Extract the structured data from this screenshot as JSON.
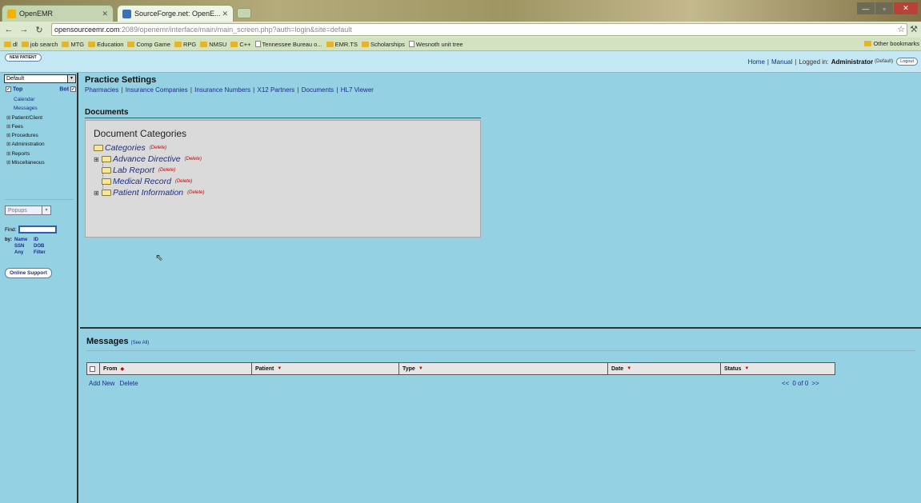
{
  "browser": {
    "tabs": [
      {
        "label": "OpenEMR",
        "active": false
      },
      {
        "label": "SourceForge.net: OpenE...",
        "active": true
      }
    ],
    "url_host": "opensourceemr.com",
    "url_path": ":2089/openemr/interface/main/main_screen.php?auth=login&site=default",
    "bookmarks": [
      "dl",
      "job search",
      "MTG",
      "Education",
      "Comp Game",
      "RPG",
      "NMSU",
      "C++",
      "Tennessee Bureau o...",
      "EMR.TS",
      "Scholarships",
      "Wesnoth unit tree"
    ],
    "other_bookmarks": "Other bookmarks"
  },
  "emr_header": {
    "new_patient_label": "NEW PATIENT",
    "home_label": "Home",
    "manual_label": "Manual",
    "logged_in_label": "Logged in:",
    "user_name": "Administrator",
    "site_label": "(Default)",
    "logout_label": "Logout"
  },
  "leftnav": {
    "frame_select": "Default",
    "top_label": "Top",
    "bot_label": "Bot",
    "items": [
      {
        "label": "Calendar",
        "kind": "sub"
      },
      {
        "label": "Messages",
        "kind": "sub"
      },
      {
        "label": "Patient/Client",
        "kind": "section"
      },
      {
        "label": "Fees",
        "kind": "section"
      },
      {
        "label": "Procedures",
        "kind": "section"
      },
      {
        "label": "Administration",
        "kind": "section"
      },
      {
        "label": "Reports",
        "kind": "section"
      },
      {
        "label": "Miscellaneous",
        "kind": "section"
      }
    ],
    "popups_label": "Popups",
    "find_label": "Find:",
    "by_label": "by:",
    "find_by": [
      "Name",
      "ID",
      "SSN",
      "DOB",
      "Any",
      "Filter"
    ],
    "online_support_label": "Online Support"
  },
  "practice_settings": {
    "title": "Practice Settings",
    "links": [
      "Pharmacies",
      "Insurance Companies",
      "Insurance Numbers",
      "X12 Partners",
      "Documents",
      "HL7 Viewer"
    ]
  },
  "documents": {
    "title": "Documents",
    "heading": "Document Categories",
    "delete_label": "(Delete)",
    "tree": [
      {
        "label": "Categories",
        "expandable": false,
        "root": true
      },
      {
        "label": "Advance Directive",
        "expandable": true,
        "root": false
      },
      {
        "label": "Lab Report",
        "expandable": false,
        "root": false
      },
      {
        "label": "Medical Record",
        "expandable": false,
        "root": false
      },
      {
        "label": "Patient Information",
        "expandable": true,
        "root": false
      }
    ]
  },
  "messages": {
    "title": "Messages",
    "see_all": "(See All)",
    "columns": [
      "From",
      "Patient",
      "Type",
      "Date",
      "Status"
    ],
    "add_new": "Add New",
    "delete": "Delete",
    "pager_prev": "<<",
    "pager_text": "0 of 0",
    "pager_next": ">>"
  },
  "colors": {
    "background": "#93d1e3",
    "link": "#1c2f87",
    "delete": "#cc0000",
    "panel": "#dadada"
  }
}
